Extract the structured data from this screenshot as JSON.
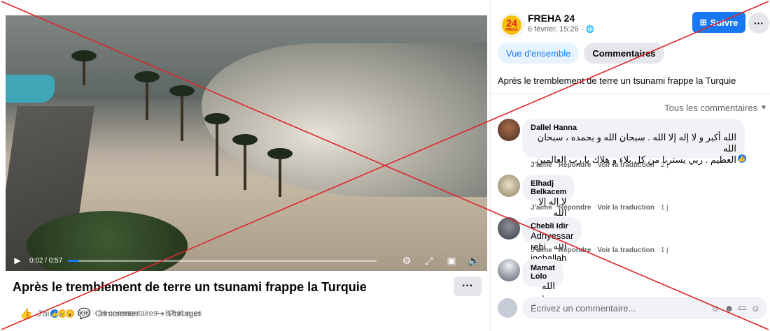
{
  "video": {
    "time": "0:02 / 0:57",
    "progress": 0.035
  },
  "post": {
    "title": "Après le tremblement de terre un tsunami frappe la Turquie",
    "more_label": "···",
    "actions": {
      "like": "J'aime",
      "comment": "Commenter",
      "share": "Partager"
    },
    "stats": {
      "reactions": "300",
      "comments": "34 commentaires",
      "views": "8,8 K vues",
      "separator": "·"
    }
  },
  "sidebar": {
    "page": {
      "logo_number": "24",
      "logo_text": "FREHA",
      "name": "FREHA 24",
      "time": "6 février, 15:26 ·"
    },
    "follow_label": "Suivre",
    "more_label": "···",
    "tabs": [
      {
        "label": "Vue d'ensemble",
        "active": true
      },
      {
        "label": "Commentaires",
        "active": false
      }
    ],
    "caption": "Après le tremblement de terre un tsunami frappe la Turquie",
    "sort_label": "Tous les commentaires",
    "comment_actions": {
      "like": "J'aime",
      "reply": "Répondre",
      "translate": "Voir la traduction"
    },
    "comments": [
      {
        "author": "Dallel Hanna",
        "lines": [
          "الله أكبر و لا إله إلا الله . سبحان الله و بحمده ، سبحان الله",
          "العظيم . ربي يسترنا من كل بلاء و هلاك يا رب العالمين ."
        ],
        "age": "2 j",
        "has_like": true
      },
      {
        "author": "Elhadj Belkacem",
        "lines": [
          "لا إله إلا الله محمد رسول الله"
        ],
        "age": "1 j",
        "has_like": false
      },
      {
        "author": "Chebli Idir",
        "lines": [
          "Adhyessar rebi inchallah"
        ],
        "age": "1 j",
        "has_like": false
      },
      {
        "author": "Mamat Lolo",
        "lines": [
          "الله يستر"
        ],
        "age": "",
        "has_like": false
      }
    ],
    "composer_placeholder": "Écrivez un commentaire..."
  },
  "colors": {
    "accent": "#1877f2",
    "overlay_x": "#e0262b"
  },
  "icons": [
    "play-icon",
    "settings-icon",
    "fullscreen-icon",
    "pip-icon",
    "mute-icon",
    "like-icon",
    "comment-icon",
    "share-icon",
    "globe-icon",
    "follow-icon",
    "sticker-icon",
    "emoji-icon",
    "gif-icon",
    "smile-icon",
    "caret-down-icon"
  ]
}
